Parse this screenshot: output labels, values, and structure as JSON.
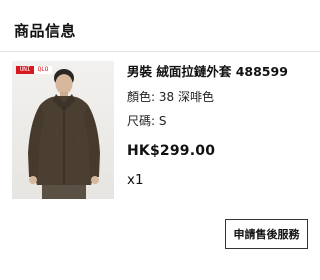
{
  "header": {
    "title": "商品信息"
  },
  "product": {
    "brand_logo_left": "UNI",
    "brand_logo_right": "QLO",
    "name": "男裝 絨面拉鏈外套 488599",
    "color_label": "顏色",
    "color_value": "38 深啡色",
    "size_label": "尺碼",
    "size_value": "S",
    "price": "HK$299.00",
    "quantity": "x1",
    "photo_icon": "model-wearing-jacket-image"
  },
  "actions": {
    "after_sales_label": "申請售後服務"
  }
}
